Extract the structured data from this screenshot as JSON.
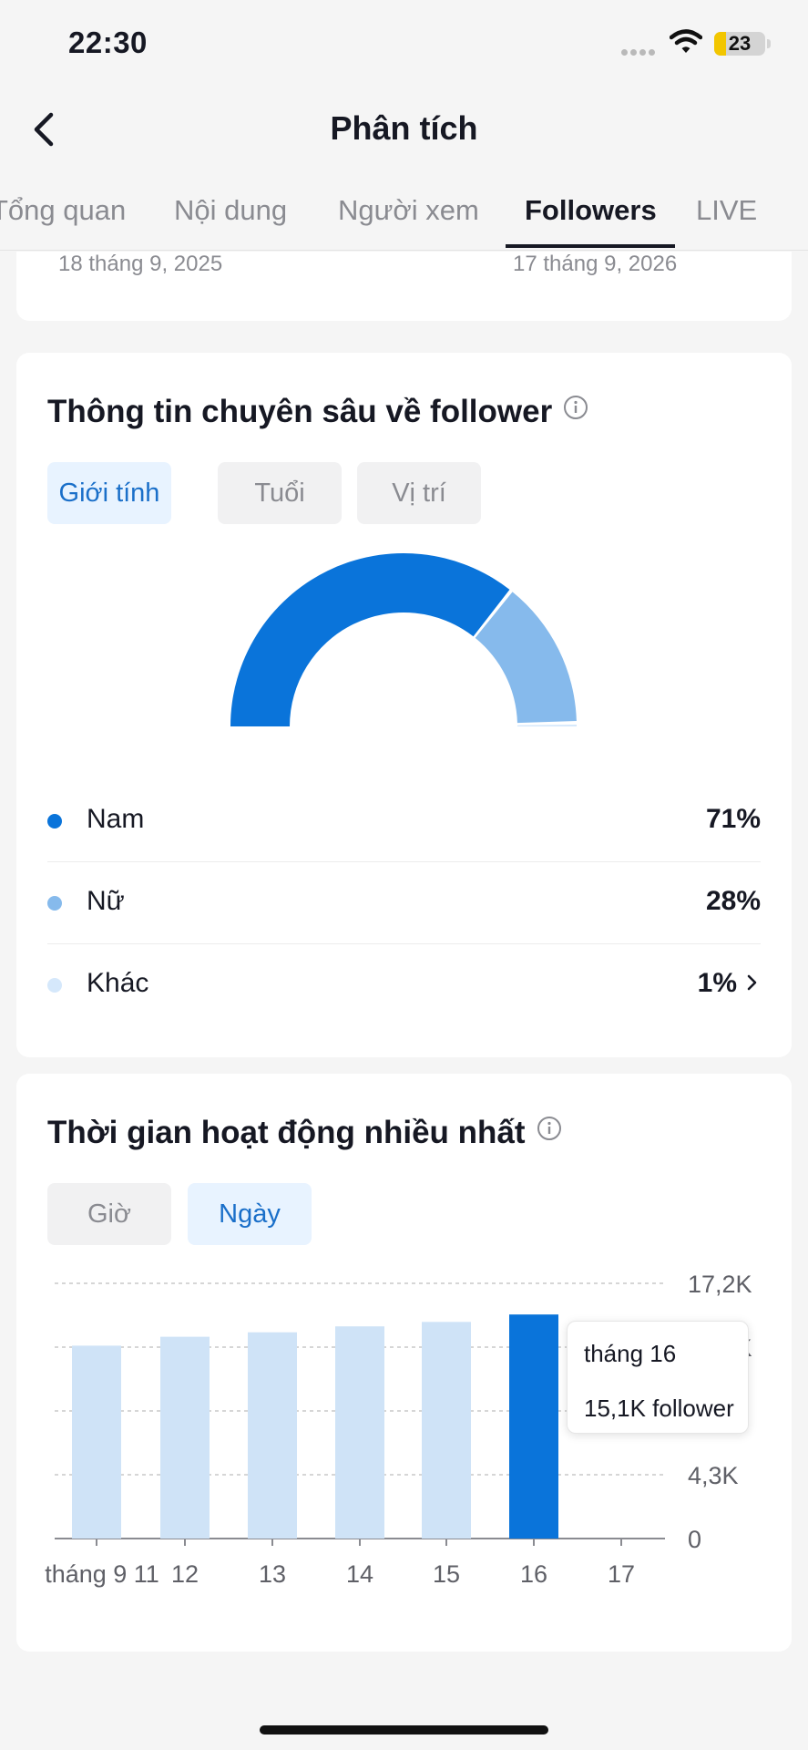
{
  "status_bar": {
    "time": "22:30",
    "battery": "23",
    "battery_level": 0.23
  },
  "header": {
    "title": "Phân tích"
  },
  "tabs": [
    {
      "label": "Tổng quan",
      "active": false
    },
    {
      "label": "Nội dung",
      "active": false
    },
    {
      "label": "Người xem",
      "active": false
    },
    {
      "label": "Followers",
      "active": true
    },
    {
      "label": "LIVE",
      "active": false
    }
  ],
  "date_range": {
    "start": "18 tháng 9, 2025",
    "end": "17 tháng 9, 2026"
  },
  "insights": {
    "title": "Thông tin chuyên sâu về follower",
    "filters": [
      {
        "label": "Giới tính",
        "active": true
      },
      {
        "label": "Tuổi",
        "active": false
      },
      {
        "label": "Vị trí",
        "active": false
      }
    ],
    "gender": [
      {
        "label": "Nam",
        "value": "71%",
        "percent": 71,
        "color": "#0a74da"
      },
      {
        "label": "Nữ",
        "value": "28%",
        "percent": 28,
        "color": "#86baec"
      },
      {
        "label": "Khác",
        "value": "1%",
        "percent": 1,
        "color": "#d5e8fb"
      }
    ]
  },
  "activity": {
    "title": "Thời gian hoạt động nhiều nhất",
    "filters": [
      {
        "label": "Giờ",
        "active": false
      },
      {
        "label": "Ngày",
        "active": true
      }
    ],
    "tooltip": {
      "day": "tháng 16",
      "value": "15,1K follower"
    }
  },
  "colors": {
    "accent": "#0a74da",
    "bar_light": "#cfe3f7",
    "accent_text": "#1a6fc9"
  },
  "chart_data": {
    "type": "bar",
    "categories": [
      "tháng 9 11",
      "12",
      "13",
      "14",
      "15",
      "16",
      "17"
    ],
    "values": [
      13.0,
      13.6,
      13.9,
      14.3,
      14.6,
      15.1,
      null
    ],
    "highlight_index": 5,
    "y_ticks": [
      "17,2K",
      "12,9K",
      "4,3K",
      "0"
    ],
    "ylim": [
      0,
      17.2
    ],
    "grid": true
  }
}
